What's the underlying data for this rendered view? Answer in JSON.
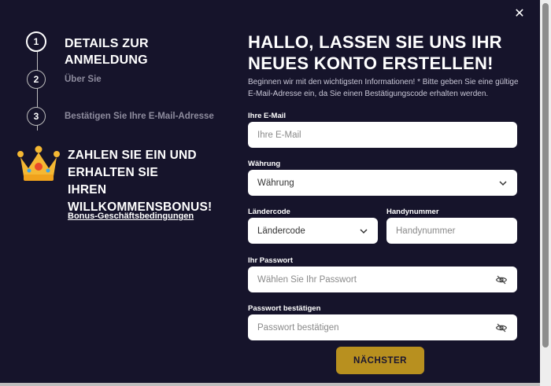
{
  "colors": {
    "background": "#16142b",
    "accent": "#b8901f",
    "field": "#ffffff"
  },
  "close_icon": "close-icon",
  "steps": [
    {
      "number": "1",
      "label": "DETAILS ZUR ANMELDUNG"
    },
    {
      "number": "2",
      "label": "Über Sie"
    },
    {
      "number": "3",
      "label": "Bestätigen Sie Ihre E-Mail-Adresse"
    }
  ],
  "bonus": {
    "title_lines": [
      "ZAHLEN SIE EIN UND",
      "ERHALTEN SIE",
      "IHREN",
      "WILLKOMMENSBONUS!"
    ],
    "terms_link": "Bonus-Geschäftsbedingungen",
    "icon": "crown-icon"
  },
  "form": {
    "title_lines": [
      "HALLO, LASSEN SIE UNS IHR",
      "NEUES KONTO ERSTELLEN!"
    ],
    "intro": "Beginnen wir mit den wichtigsten Informationen! * Bitte geben Sie eine gültige E-Mail-Adresse ein, da Sie einen Bestätigungscode erhalten werden.",
    "email": {
      "label": "Ihre E-Mail",
      "placeholder": "Ihre E-Mail",
      "value": ""
    },
    "currency": {
      "label": "Währung",
      "selected": "Währung"
    },
    "country_code": {
      "label": "Ländercode",
      "selected": "Ländercode"
    },
    "phone": {
      "label": "Handynummer",
      "placeholder": "Handynummer",
      "value": ""
    },
    "password": {
      "label": "Ihr Passwort",
      "placeholder": "Wählen Sie Ihr Passwort",
      "value": ""
    },
    "password_confirm": {
      "label": "Passwort bestätigen",
      "placeholder": "Passwort bestätigen",
      "value": ""
    },
    "next_button": "NÄCHSTER"
  }
}
